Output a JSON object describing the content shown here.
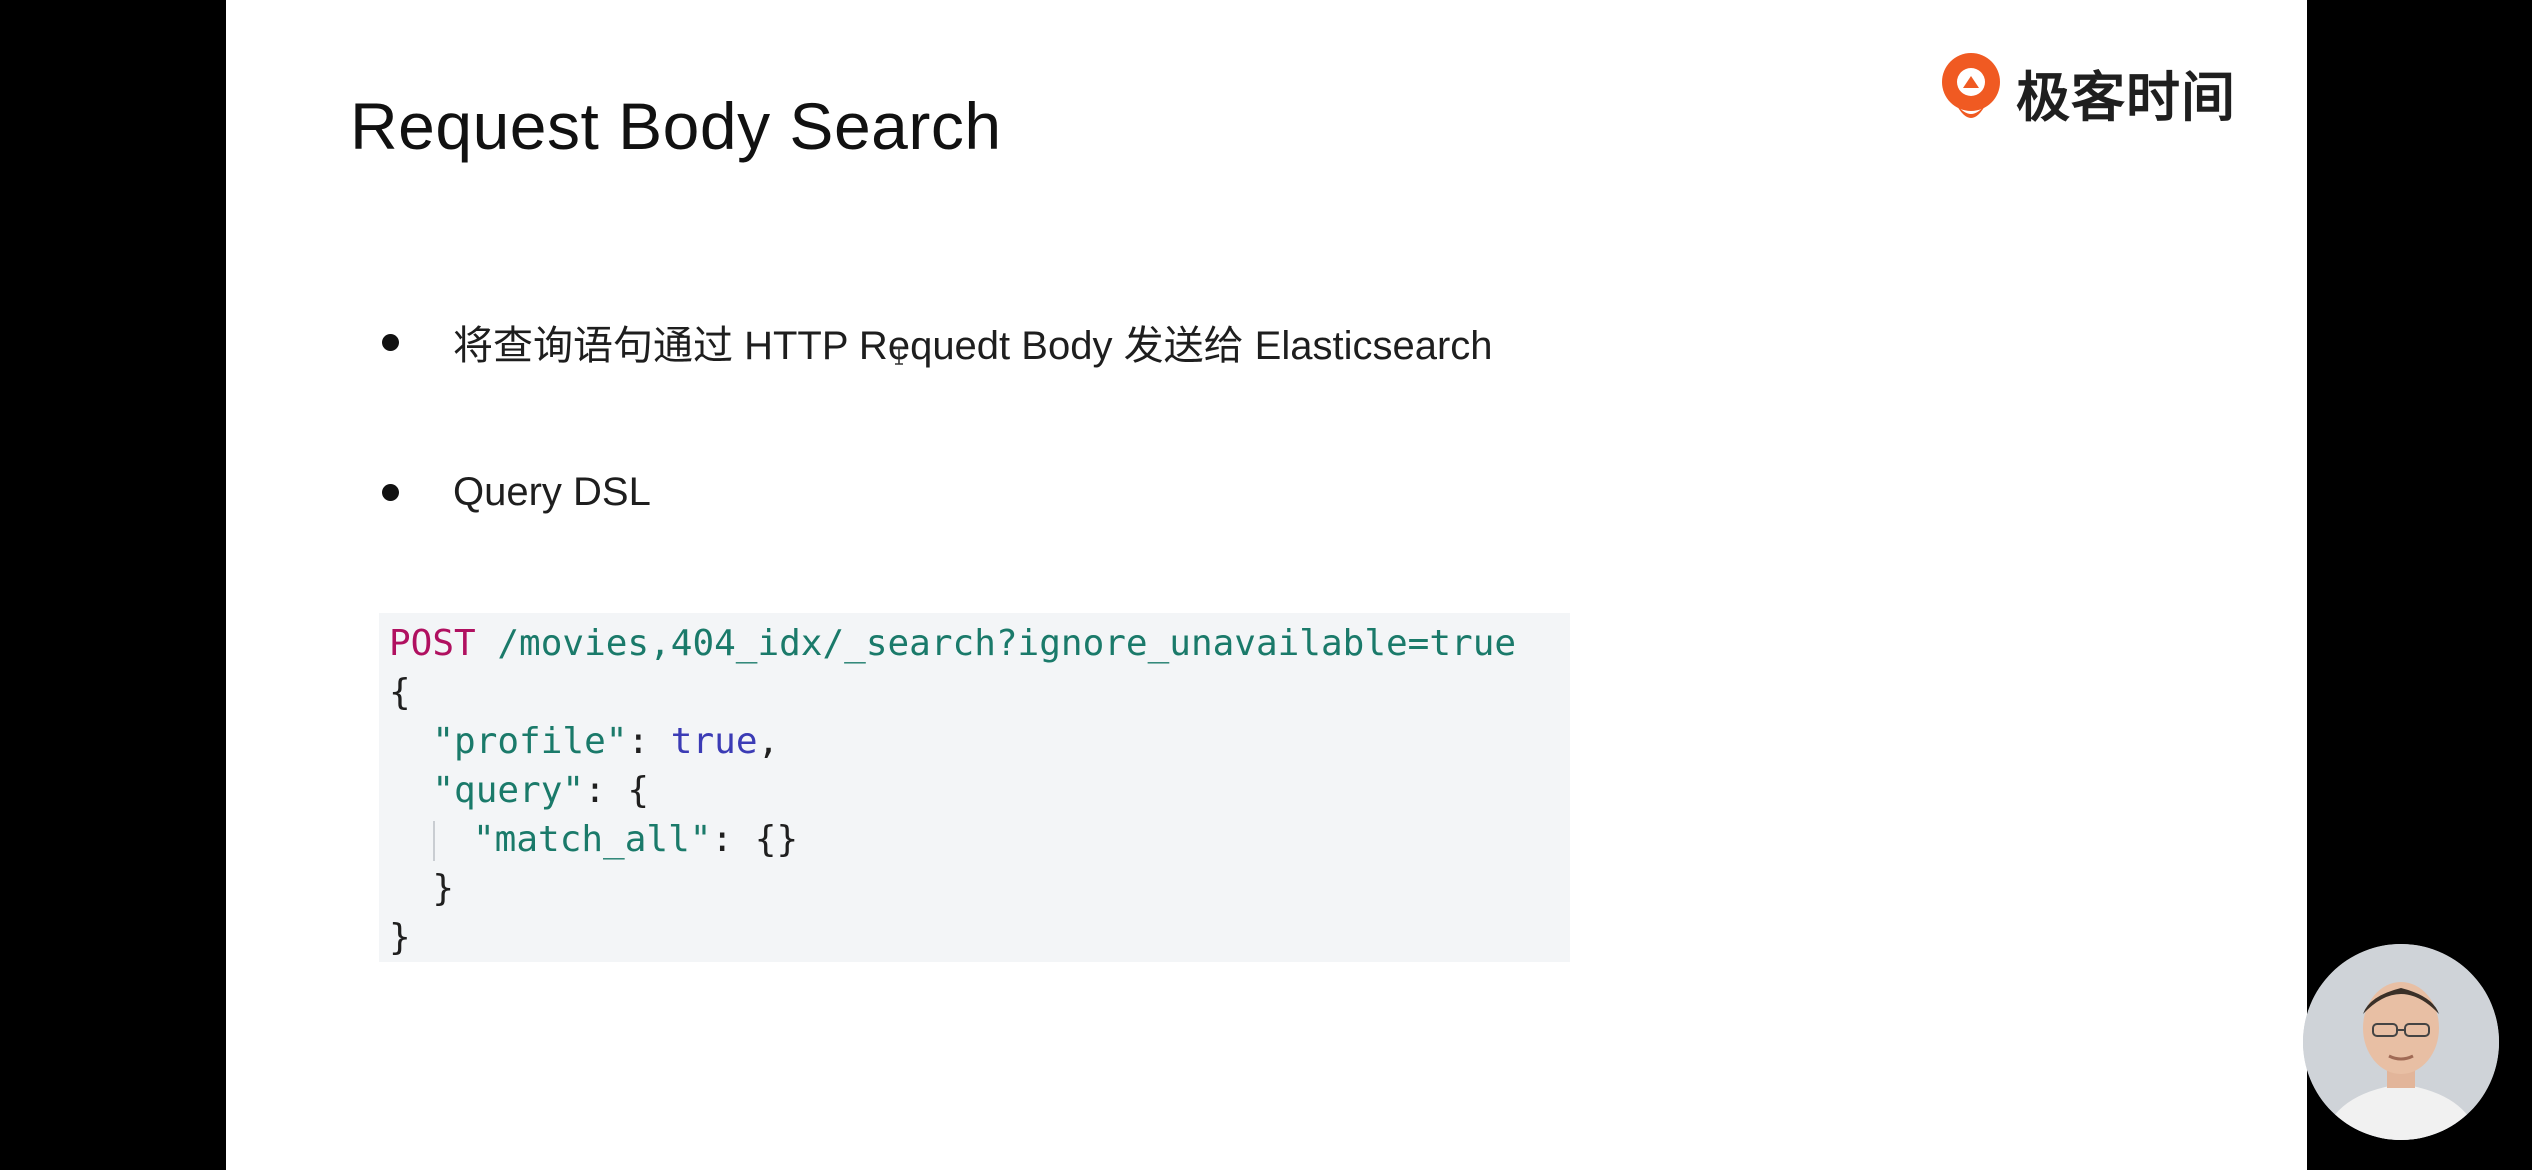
{
  "slide": {
    "title": "Request Body Search",
    "logo": {
      "text": "极客时间",
      "icon": "geektime-logo-icon",
      "brand_color": "#f05a22"
    },
    "bullets": [
      {
        "text": "将查询语句通过 HTTP Requedt Body 发送给 Elasticsearch"
      },
      {
        "text": "Query DSL"
      }
    ],
    "code": {
      "method": "POST",
      "path": " /movies,404_idx/_search?ignore_unavailable=true",
      "line2": "{",
      "line3_key": "\"profile\"",
      "line3_sep": ": ",
      "line3_value": "true",
      "line3_end": ",",
      "line4_key": "\"query\"",
      "line4_rest": ": {",
      "line5_key": "\"match_all\"",
      "line5_rest": ": {}",
      "line6": "}",
      "line7": "}",
      "colors": {
        "method": "#b01060",
        "key": "#1a7a6a",
        "bool": "#3b3bb5",
        "background": "#f3f5f7"
      }
    },
    "presenter": {
      "icon": "presenter-video-avatar"
    }
  }
}
